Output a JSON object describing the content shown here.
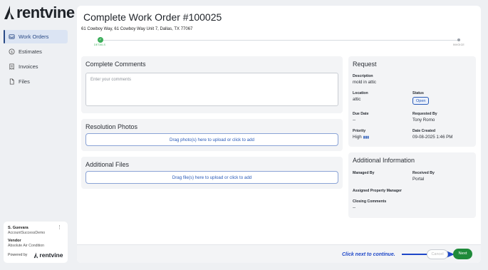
{
  "brand": {
    "name": "rentvine"
  },
  "sidebar": {
    "items": [
      {
        "label": "Work Orders",
        "icon": "inbox-icon",
        "active": true
      },
      {
        "label": "Estimates",
        "icon": "dollar-circle-icon",
        "active": false
      },
      {
        "label": "Invoices",
        "icon": "receipt-icon",
        "active": false
      },
      {
        "label": "Files",
        "icon": "file-icon",
        "active": false
      }
    ]
  },
  "user": {
    "name": "S. Guevara",
    "account": "AccountSuccessDemo",
    "role": "Vendor",
    "company": "Absolute Air Condition",
    "powered_by": "Powered by"
  },
  "page": {
    "title": "Complete Work Order #100025",
    "address": "61 Cowboy Way, 61 Cowboy Way Unit 7, Dallas, TX 77067"
  },
  "stepper": {
    "steps": [
      {
        "label": "DETAILS",
        "done": true
      },
      {
        "label": "INVOICE",
        "done": false
      }
    ]
  },
  "comments": {
    "title": "Complete Comments",
    "placeholder": "Enter your comments"
  },
  "resolution_photos": {
    "title": "Resolution Photos",
    "drop_label": "Drag photo(s) here to upload or click to add"
  },
  "additional_files": {
    "title": "Additional Files",
    "drop_label": "Drag file(s) here to upload or click to add"
  },
  "request": {
    "title": "Request",
    "description_label": "Description",
    "description": "mold in attic",
    "location_label": "Location",
    "location": "attic",
    "status_label": "Status",
    "status": "Open",
    "due_date_label": "Due Date",
    "due_date": "--",
    "requested_by_label": "Requested By",
    "requested_by": "Tony Romo",
    "priority_label": "Priority",
    "priority": "High",
    "date_created_label": "Date Created",
    "date_created": "09-08-2025 1:46 PM"
  },
  "additional_info": {
    "title": "Additional Information",
    "managed_by_label": "Managed By",
    "managed_by": "",
    "received_by_label": "Received By",
    "received_by": "Portal",
    "assigned_pm_label": "Assigned Property Manager",
    "assigned_pm": "",
    "closing_comments_label": "Closing Comments",
    "closing_comments": "--"
  },
  "footer": {
    "hint": "Click next to continue.",
    "cancel_label": "Cancel",
    "next_label": "Next"
  },
  "colors": {
    "accent": "#2a5bb8",
    "success": "#1f8a3a",
    "hint": "#1e47c8"
  }
}
